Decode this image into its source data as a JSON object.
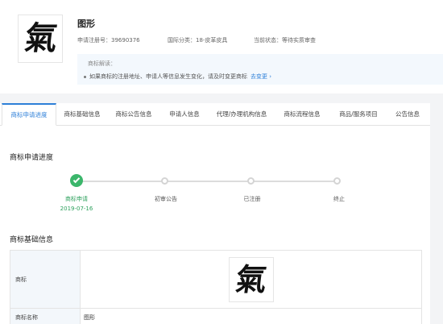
{
  "header": {
    "trademark_name": "图形",
    "reg_no": "申请注册号：39690376",
    "intl_class": "国际分类：18-皮革皮具",
    "status": "当前状态：等待实质审查",
    "logo_char": "氣"
  },
  "notice": {
    "title": "商标解读：",
    "text": "如果商标的注册地址、申请人等信息发生变化，请及时变更商标",
    "link": "去变更"
  },
  "tabs": [
    {
      "label": "商标申请进度",
      "active": true
    },
    {
      "label": "商标基础信息"
    },
    {
      "label": "商标公告信息"
    },
    {
      "label": "申请人信息"
    },
    {
      "label": "代理/办理机构信息"
    },
    {
      "label": "商标流程信息"
    },
    {
      "label": "商品/服务项目"
    },
    {
      "label": "公告信息"
    }
  ],
  "progress": {
    "title": "商标申请进度",
    "steps": [
      {
        "label": "商标申请",
        "date": "2019-07-16",
        "done": true
      },
      {
        "label": "初审公告"
      },
      {
        "label": "已注册"
      },
      {
        "label": "终止"
      }
    ]
  },
  "basic_info": {
    "title": "商标基础信息",
    "rows": [
      {
        "key": "商标",
        "logo_char": "氣"
      },
      {
        "key": "商标名称",
        "value": "图形"
      }
    ]
  },
  "colors": {
    "accent": "#2d7fd8",
    "success": "#3bb66b"
  }
}
